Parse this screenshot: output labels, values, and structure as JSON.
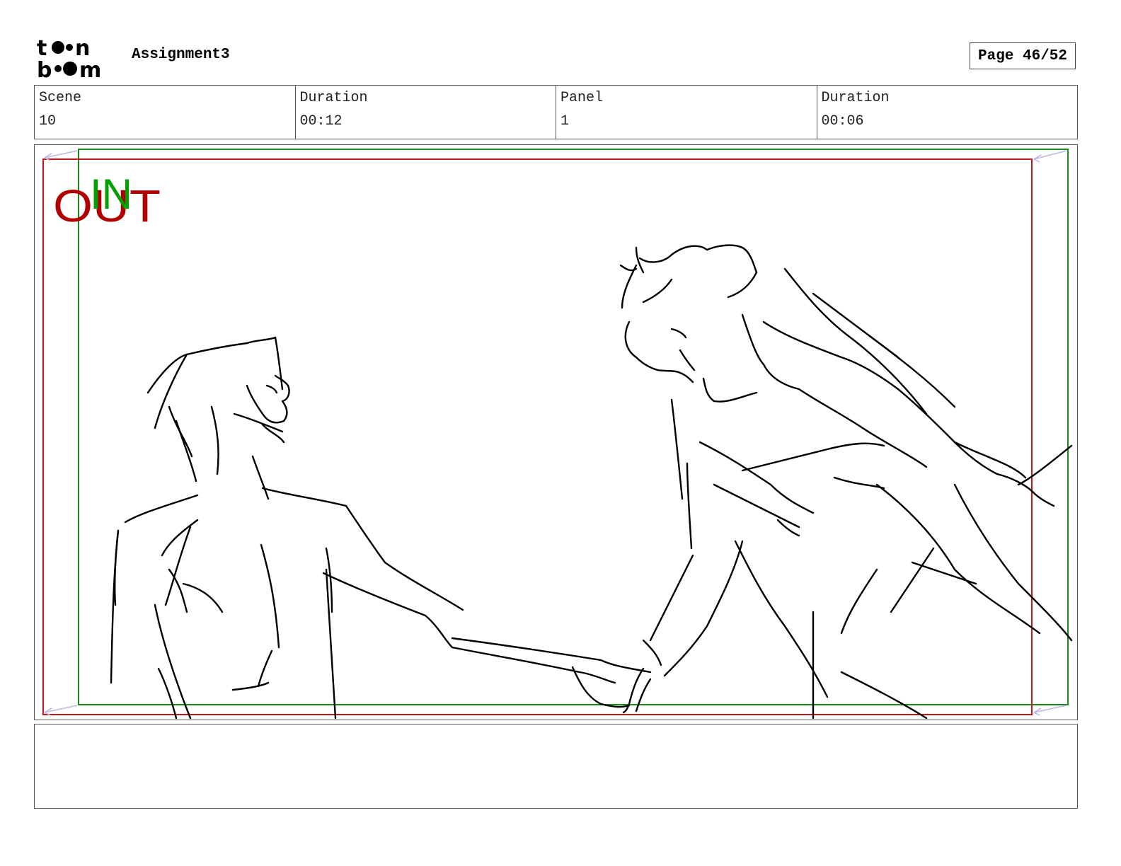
{
  "header": {
    "logo_text": "toon boom",
    "project_title": "Assignment3",
    "page_label": "Page 46/52"
  },
  "info": {
    "scene_label": "Scene",
    "scene_value": "10",
    "scene_duration_label": "Duration",
    "scene_duration_value": "00:12",
    "panel_label": "Panel",
    "panel_value": "1",
    "panel_duration_label": "Duration",
    "panel_duration_value": "00:06"
  },
  "panel": {
    "in_label": "IN",
    "out_label": "OUT",
    "in_color": "#00a000",
    "out_color": "#b00000"
  },
  "notes": {
    "text": ""
  }
}
